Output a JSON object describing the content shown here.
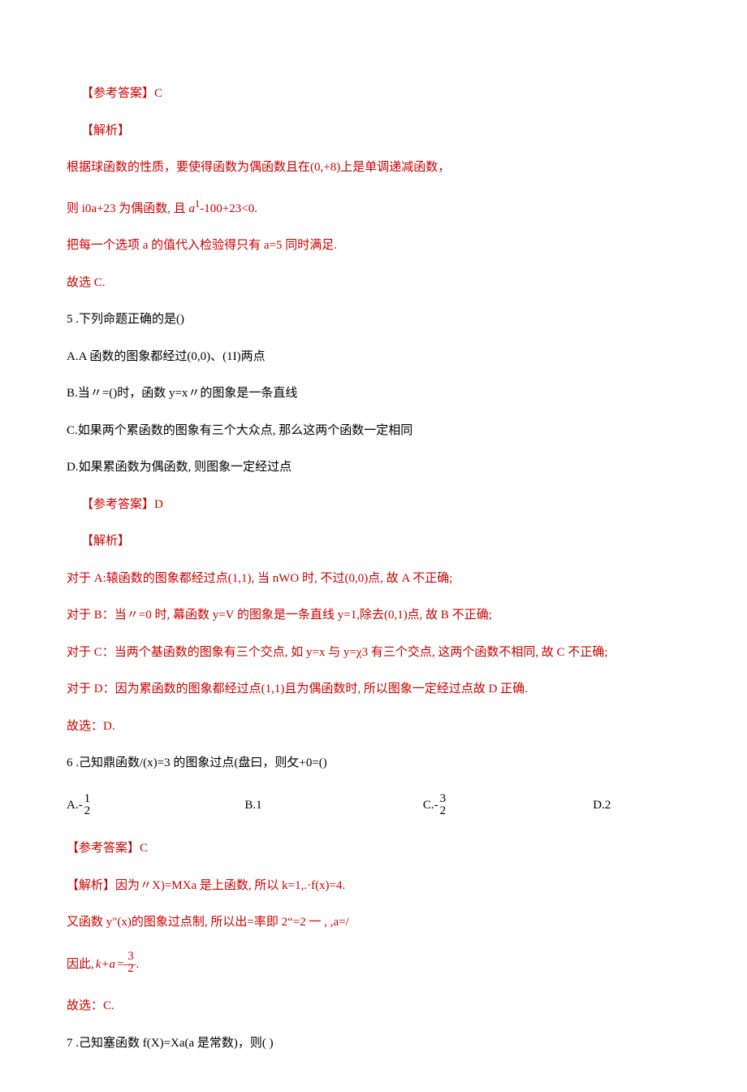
{
  "block1": {
    "answer_label": "【参考答案】C",
    "analysis_label": "【解析】",
    "line1": "根据球函数的性质，要使得函数为偶函数且在(0,+8)上是单调递减函数，",
    "line2_pre": "则 i0a+23 为偶函数, 且 ",
    "line2_ital": "a",
    "line2_sup": "1",
    "line2_post": "-100+23<0.",
    "line3": "把每一个选项 a 的值代入检验得只有 a=5 同时满足.",
    "line4": "故选 C."
  },
  "q5": {
    "stem": "5  .下列命题正确的是()",
    "optA": "A.A 函数的图象都经过(0,0)、(1I)两点",
    "optB": "B.当〃=()时，函数 y=x〃的图象是一条直线",
    "optC": "C.如果两个累函数的图象有三个大众点, 那么这两个函数一定相同",
    "optD": "D.如果累函数为偶函数, 则图象一定经过点",
    "answer_label": "【参考答案】D",
    "analysis_label": "【解析】",
    "expA": "对于 A:辕函数的图象都经过点(1,1), 当 nWO 时, 不过(0,0)点, 故 A 不正确;",
    "expB": "对于 B：当〃=0 时, 幕函数 y=V 的图象是一条直线 y=1,除去(0,1)点, 故 B 不正确;",
    "expC": "对于 C：当两个基函数的图象有三个交点, 如 y=x 与 y=χ3 有三个交点, 这两个函数不相同, 故 C 不正确;",
    "expD": "对于 D：因为累函数的图象都经过点(1,1)且为偶函数时, 所以图象一定经过点故 D 正确.",
    "conclude": "故选：D."
  },
  "q6": {
    "stem": "6  .己知鼎函数/(x)=3 的图象过点(盘曰，则攵+0=()",
    "optA_prefix": "A.-",
    "optA_num": "1",
    "optA_den": "2",
    "optB": "B.1",
    "optC_prefix": "C.-",
    "optC_num": "3",
    "optC_den": "2",
    "optD": "D.2",
    "answer_label": "【参考答案】C",
    "analysis": "【解析】因为〃X)=MXa 是上函数, 所以 k=1,.·f(x)=4.",
    "line2": "又函数 y\"(x)的图象过点制, 所以出=率即 2“=2 一 , ,a=/",
    "line3_pre": "因此,  ",
    "line3_ital": "k+a",
    "line3_mid": "=—.",
    "line3_num": "3",
    "line3_den": "2",
    "conclude": "故选：C."
  },
  "q7": {
    "stem": "7  .己知塞函数 f(X)=Xa(a 是常数)，则(           )"
  }
}
